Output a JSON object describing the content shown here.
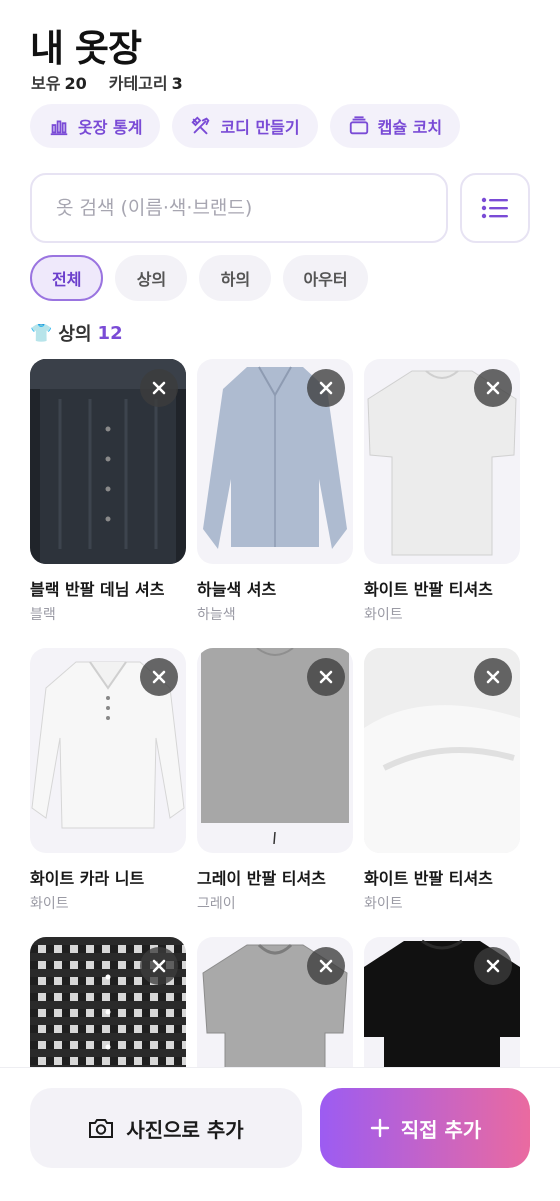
{
  "header": {
    "title": "내 옷장",
    "owned_label": "보유",
    "owned_count": "20",
    "category_label": "카테고리",
    "category_count": "3"
  },
  "actions": [
    {
      "label": "옷장 통계",
      "icon": "bar-chart-icon"
    },
    {
      "label": "코디 만들기",
      "icon": "tools-icon"
    },
    {
      "label": "캡슐 코치",
      "icon": "capsule-box-icon"
    }
  ],
  "search": {
    "placeholder": "옷 검색 (이름·색·브랜드)",
    "value": ""
  },
  "filters": [
    {
      "label": "전체",
      "active": true
    },
    {
      "label": "상의",
      "active": false
    },
    {
      "label": "하의",
      "active": false
    },
    {
      "label": "아우터",
      "active": false
    }
  ],
  "section": {
    "emoji": "👕",
    "label": "상의",
    "count": "12"
  },
  "items": [
    {
      "name": "블랙 반팔 데님 셔츠",
      "color": "블랙"
    },
    {
      "name": "하늘색 셔츠",
      "color": "하늘색"
    },
    {
      "name": "화이트 반팔 티셔츠",
      "color": "화이트"
    },
    {
      "name": "화이트 카라 니트",
      "color": "화이트"
    },
    {
      "name": "그레이 반팔 티셔츠",
      "color": "그레이"
    },
    {
      "name": "화이트 반팔 티셔츠",
      "color": "화이트"
    },
    {
      "name": "",
      "color": ""
    },
    {
      "name": "",
      "color": ""
    },
    {
      "name": "",
      "color": ""
    }
  ],
  "bottom": {
    "photo_label": "사진으로 추가",
    "add_label": "직접 추가"
  },
  "colors": {
    "accent": "#7a4bd6",
    "gradient_start": "#9c5cf2",
    "gradient_end": "#ea6aa0"
  }
}
